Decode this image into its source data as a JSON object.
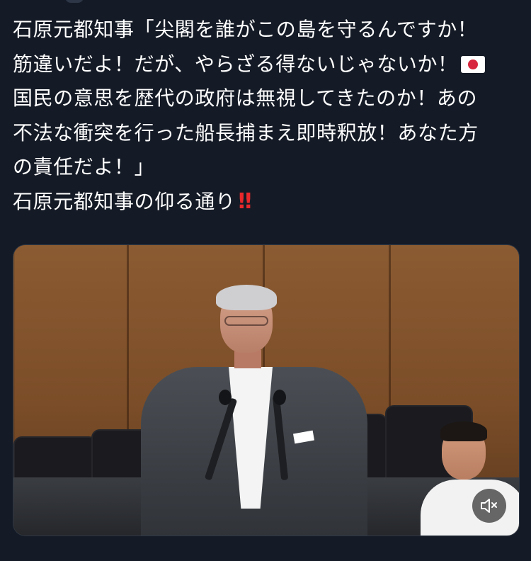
{
  "post": {
    "lines": [
      "石原元都知事「尖閣を誰がこの島を守るんですか！",
      "筋違いだよ！だが、やらざる得ないじゃないか！",
      "国民の意思を歴代の政府は無視してきたのか！あの",
      "不法な衝突を行った船長捕まえ即時釈放！あなた方",
      "の責任だよ！」",
      "石原元都知事の仰る通り"
    ],
    "flag_icon": "japan-flag-icon",
    "emphasis_icon": "double-exclamation-icon",
    "emphasis_text": "‼"
  },
  "video": {
    "mute_icon": "speaker-muted-icon",
    "colors": {
      "background": "#151b26",
      "text": "#ffffff",
      "emphasis": "#e8282b",
      "mute_button_bg": "rgba(0,0,0,0.58)"
    }
  }
}
